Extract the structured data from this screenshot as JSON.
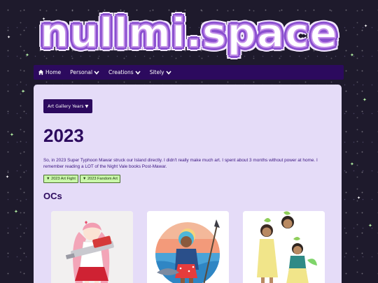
{
  "site": {
    "logo": "nullmi.space"
  },
  "nav": {
    "items": [
      {
        "label": "Home",
        "icon": "home-icon"
      },
      {
        "label": "Personal",
        "icon": "chevron-down-icon"
      },
      {
        "label": "Creations",
        "icon": "chevron-down-icon"
      },
      {
        "label": "Sitely",
        "icon": "chevron-down-icon"
      }
    ]
  },
  "content": {
    "gallery_button": "Art Gallery Years ▼",
    "year_title": "2023",
    "intro": "So, in 2023 Super Typhoon Mawar struck our Island directly. I didn't really make much art. I spent about 3 months without power at home. I remember reading a LOT of the Night Vale books Post-Mawar.",
    "tags": [
      "▼ 2023 Art Fight",
      "▼ 2023 Fandom Art"
    ],
    "section_title": "OCs"
  },
  "colors": {
    "nav_bg": "#2c0a5e",
    "panel_bg": "#e5dcf8",
    "tag_bg": "#c9f7a9",
    "logo_outline": "#8a4fcf",
    "page_bg": "#1e1a2c"
  }
}
